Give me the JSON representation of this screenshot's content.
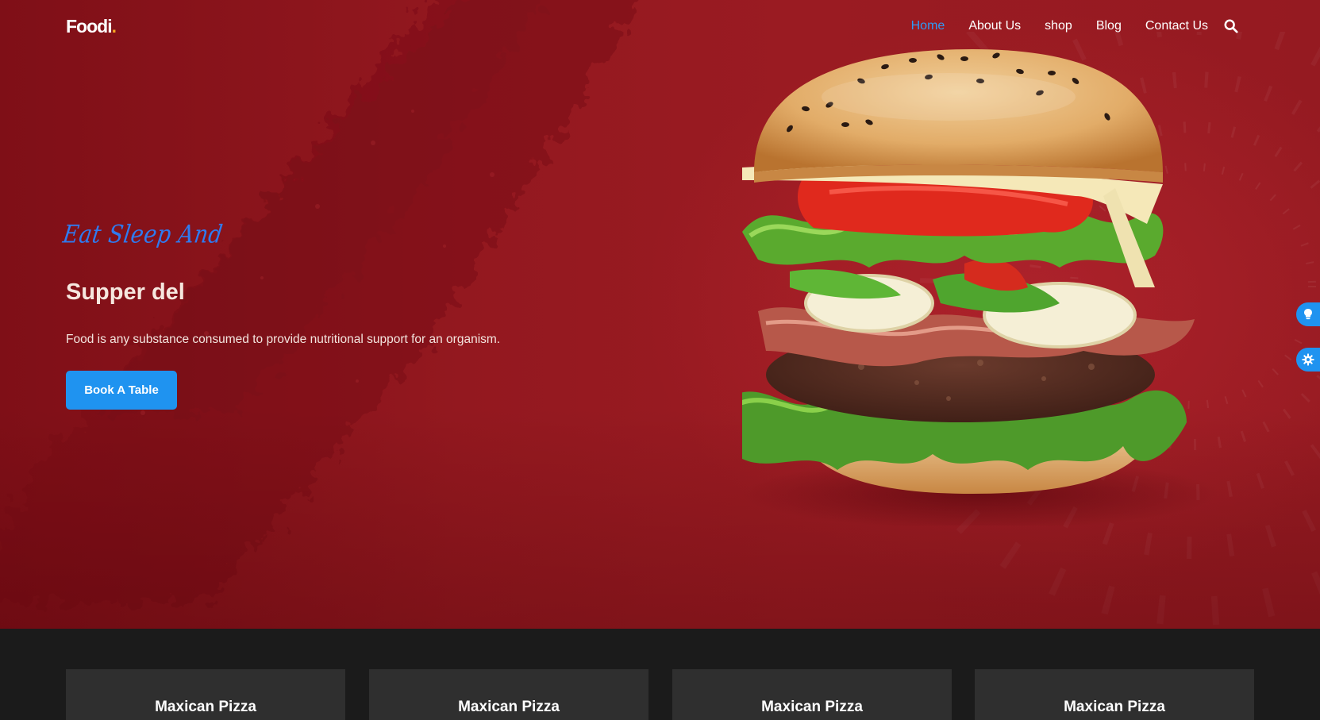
{
  "brand": {
    "name": "Foodi",
    "dot": "."
  },
  "nav": {
    "items": [
      {
        "label": "Home",
        "active": true
      },
      {
        "label": "About Us",
        "active": false
      },
      {
        "label": "shop",
        "active": false
      },
      {
        "label": "Blog",
        "active": false
      },
      {
        "label": "Contact Us",
        "active": false
      }
    ],
    "search_icon": "search-icon"
  },
  "hero": {
    "tagline": "Eat Sleep And",
    "title": "Supper del",
    "description": "Food is any substance consumed to provide nutritional support for an organism.",
    "cta_label": "Book A Table",
    "image": "burger-image"
  },
  "side_tabs": [
    {
      "icon": "lightbulb-icon"
    },
    {
      "icon": "gear-icon"
    }
  ],
  "cards": [
    {
      "title": "Maxican Pizza"
    },
    {
      "title": "Maxican Pizza"
    },
    {
      "title": "Maxican Pizza"
    },
    {
      "title": "Maxican Pizza"
    }
  ],
  "colors": {
    "hero_bg": "#951a21",
    "accent": "#1f93f0",
    "nav_active": "#2f9bf5",
    "section_bg": "#1b1b1b",
    "card_bg": "#2f2f2f"
  }
}
